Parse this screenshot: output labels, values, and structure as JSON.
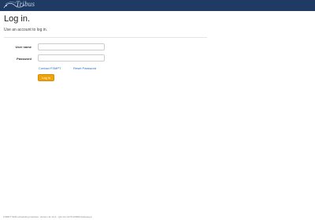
{
  "brand": {
    "logo_text": "Tribus",
    "topbar_color": "#1f3a63"
  },
  "header": {
    "title": "Log in.",
    "subtitle": "Use an account to log in."
  },
  "form": {
    "username_label": "User name",
    "username_value": "",
    "password_label": "Password",
    "password_value": "",
    "contact_link": "Contact FSMPT",
    "reset_link": "Reset Password",
    "login_button": "Log in"
  },
  "footer": {
    "text": "FSMPT SMS scheduling interface. Version 11.13.4 - ({11.13.4.975.22068} (Release))"
  },
  "colors": {
    "accent": "#f0a30a",
    "link": "#2a6ebb"
  }
}
